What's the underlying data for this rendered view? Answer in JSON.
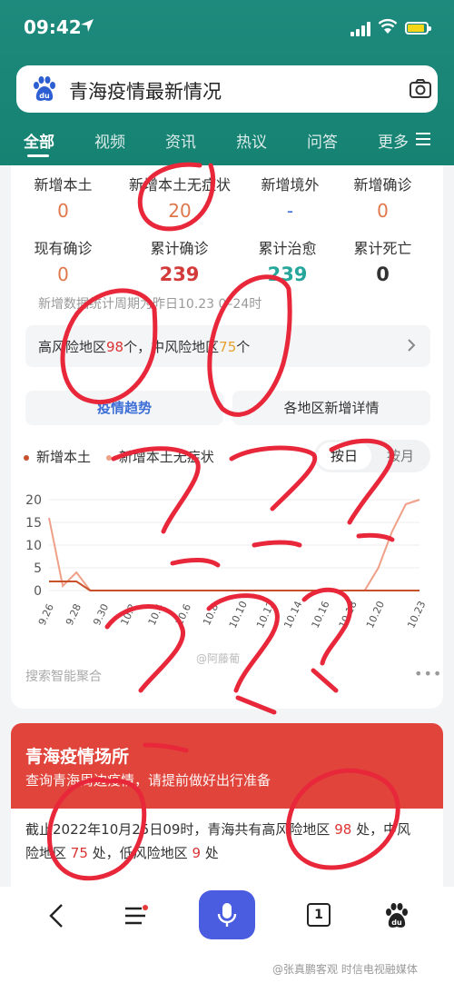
{
  "status_bar": {
    "time": "09:42"
  },
  "search": {
    "query": "青海疫情最新情况"
  },
  "tabs": [
    {
      "label": "全部"
    },
    {
      "label": "视频"
    },
    {
      "label": "资讯"
    },
    {
      "label": "热议"
    },
    {
      "label": "问答"
    },
    {
      "label": "更多"
    }
  ],
  "stats": [
    {
      "label": "新增本土",
      "value": "0",
      "color": "#e0774b"
    },
    {
      "label": "新增本土无症状",
      "value": "20",
      "color": "#e0774b"
    },
    {
      "label": "新增境外",
      "value": "-",
      "color": "#3d6fd6"
    },
    {
      "label": "新增确诊",
      "value": "0",
      "color": "#e0774b"
    },
    {
      "label": "现有确诊",
      "value": "0",
      "color": "#e0774b"
    },
    {
      "label": "累计确诊",
      "value": "239",
      "color": "#d33b3b"
    },
    {
      "label": "累计治愈",
      "value": "239",
      "color": "#26a69a"
    },
    {
      "label": "累计死亡",
      "value": "0",
      "color": "#333333"
    }
  ],
  "stats_note": "新增数据统计周期为昨日10.23 0–24时",
  "risk": {
    "high_label": "高风险地区",
    "high_count": "98",
    "mid_label": "中风险地区",
    "mid_count": "75",
    "unit": "个"
  },
  "buttons": {
    "trend": "疫情趋势",
    "regions": "各地区新增详情"
  },
  "legend": {
    "series1": "新增本土",
    "series2": "新增本土无症状"
  },
  "toggle": {
    "by_day": "按日",
    "by_month": "按月"
  },
  "chart_data": {
    "type": "line",
    "x": [
      "9.26",
      "9.27",
      "9.28",
      "9.29",
      "9.30",
      "10.1",
      "10.2",
      "10.3",
      "10.4",
      "10.5",
      "10.6",
      "10.7",
      "10.8",
      "10.9",
      "10.10",
      "10.11",
      "10.12",
      "10.13",
      "10.14",
      "10.15",
      "10.16",
      "10.17",
      "10.18",
      "10.19",
      "10.20",
      "10.21",
      "10.22",
      "10.23"
    ],
    "x_tick_labels": [
      "9.26",
      "9.28",
      "9.30",
      "10.2",
      "10.4",
      "10.6",
      "10.8",
      "10.10",
      "10.12",
      "10.14",
      "10.16",
      "10.18",
      "10.20",
      "10.23"
    ],
    "series": [
      {
        "name": "新增本土",
        "color": "#c8502a",
        "values": [
          2,
          2,
          2,
          0,
          0,
          0,
          0,
          0,
          0,
          0,
          0,
          0,
          0,
          0,
          0,
          0,
          0,
          0,
          0,
          0,
          0,
          0,
          0,
          0,
          0,
          0,
          0,
          0
        ]
      },
      {
        "name": "新增本土无症状",
        "color": "#efa088",
        "values": [
          16,
          1,
          4,
          0,
          0,
          0,
          0,
          0,
          0,
          0,
          0,
          0,
          0,
          0,
          0,
          0,
          0,
          0,
          0,
          0,
          0,
          0,
          0,
          0,
          5,
          13,
          19,
          20
        ]
      }
    ],
    "ylim": [
      0,
      20
    ],
    "yticks": [
      "0",
      "5",
      "10",
      "15",
      "20"
    ]
  },
  "chart_watermark": "@阿藤葡",
  "source_label": "搜索智能聚合",
  "places_card": {
    "title": "青海疫情场所",
    "subtitle": "查询青海周边疫情，请提前做好出行准备",
    "line1_prefix": "截止2022年10月25日09时，青海共有高风险地区",
    "high_count": "98",
    "line1_suffix": "处，中风",
    "line2_prefix": "险地区",
    "mid_count": "75",
    "line2_middle": "处，低风险地区",
    "low_count": "9",
    "line2_suffix": "处"
  },
  "nav": {
    "tab_count": "1"
  },
  "watermark": "@张真鹏客观 时信电视融媒体"
}
